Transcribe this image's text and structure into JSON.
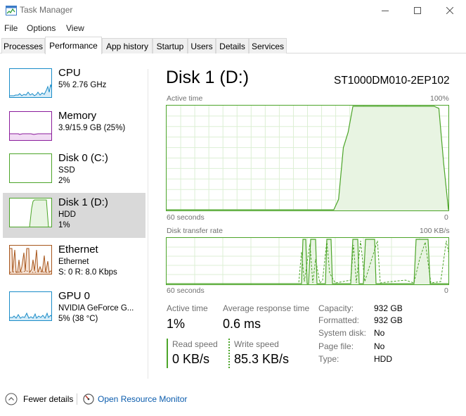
{
  "window": {
    "title": "Task Manager"
  },
  "menu": [
    "File",
    "Options",
    "View"
  ],
  "tabs": [
    "Processes",
    "Performance",
    "App history",
    "Startup",
    "Users",
    "Details",
    "Services"
  ],
  "active_tab": "Performance",
  "sidebar": {
    "items": [
      {
        "title": "CPU",
        "line1": "5%  2.76 GHz",
        "line2": "",
        "color": "#1a8cc8"
      },
      {
        "title": "Memory",
        "line1": "3.9/15.9 GB (25%)",
        "line2": "",
        "color": "#8b1c9c"
      },
      {
        "title": "Disk 0 (C:)",
        "line1": "SSD",
        "line2": "2%",
        "color": "#4ca529"
      },
      {
        "title": "Disk 1 (D:)",
        "line1": "HDD",
        "line2": "1%",
        "color": "#4ca529"
      },
      {
        "title": "Ethernet",
        "line1": "Ethernet",
        "line2": "S: 0  R: 8.0 Kbps",
        "color": "#a7561c"
      },
      {
        "title": "GPU 0",
        "line1": "NVIDIA GeForce G...",
        "line2": "5%  (38 °C)",
        "color": "#1a8cc8"
      }
    ],
    "selected_index": 3
  },
  "main": {
    "title": "Disk 1 (D:)",
    "model": "ST1000DM010-2EP102",
    "active_time_graph": {
      "label": "Active time",
      "max_label": "100%",
      "time_label": "60 seconds",
      "min_label": "0",
      "data": [
        0,
        0,
        0,
        0,
        0,
        0,
        0,
        0,
        0,
        0,
        0,
        0,
        0,
        0,
        0,
        0,
        0,
        0,
        0,
        0,
        0,
        0,
        0,
        0,
        0,
        0,
        0,
        0,
        0,
        0,
        0,
        0,
        0,
        0,
        0,
        0,
        10,
        60,
        75,
        100,
        100,
        100,
        100,
        100,
        100,
        100,
        100,
        100,
        100,
        100,
        100,
        100,
        100,
        100,
        100,
        100,
        100,
        98,
        45,
        0
      ]
    },
    "transfer_graph": {
      "label": "Disk transfer rate",
      "max_label": "100 KB/s",
      "time_label": "60 seconds",
      "min_label": "0"
    },
    "stats": {
      "active_time_label": "Active time",
      "active_time_value": "1%",
      "avg_response_label": "Average response time",
      "avg_response_value": "0.6 ms",
      "read_speed_label": "Read speed",
      "read_speed_value": "0 KB/s",
      "write_speed_label": "Write speed",
      "write_speed_value": "85.3 KB/s"
    },
    "properties": [
      {
        "label": "Capacity:",
        "value": "932 GB"
      },
      {
        "label": "Formatted:",
        "value": "932 GB"
      },
      {
        "label": "System disk:",
        "value": "No"
      },
      {
        "label": "Page file:",
        "value": "No"
      },
      {
        "label": "Type:",
        "value": "HDD"
      }
    ]
  },
  "footer": {
    "fewer_details": "Fewer details",
    "open_resource_monitor": "Open Resource Monitor"
  },
  "colors": {
    "disk_green": "#4ca529",
    "disk_fill": "#e8f4e2",
    "link_blue": "#0b5cad",
    "selected_bg": "#d9d9d9"
  }
}
